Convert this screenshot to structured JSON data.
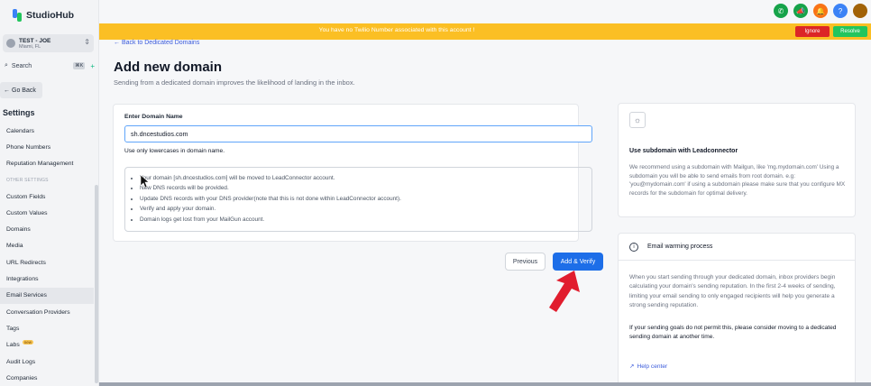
{
  "brand": {
    "name": "StudioHub"
  },
  "account": {
    "name": "TEST - JOE",
    "location": "Miami, FL"
  },
  "search": {
    "label": "Search",
    "shortcut": "⌘K",
    "plus": "+"
  },
  "sidebar": {
    "back_label": "Go Back",
    "settings_title": "Settings",
    "items": [
      {
        "label": "Calendars"
      },
      {
        "label": "Phone Numbers"
      },
      {
        "label": "Reputation Management"
      },
      {
        "label": "OTHER SETTINGS",
        "section": true
      },
      {
        "label": "Custom Fields"
      },
      {
        "label": "Custom Values"
      },
      {
        "label": "Domains"
      },
      {
        "label": "Media"
      },
      {
        "label": "URL Redirects"
      },
      {
        "label": "Integrations"
      },
      {
        "label": "Email Services",
        "active": true
      },
      {
        "label": "Conversation Providers"
      },
      {
        "label": "Tags"
      },
      {
        "label": "Labs",
        "badge": "new"
      },
      {
        "label": "Audit Logs"
      },
      {
        "label": "Companies"
      }
    ]
  },
  "top_icons": [
    {
      "name": "phone-icon",
      "glyph": "✆",
      "color": "#16a34a"
    },
    {
      "name": "megaphone-icon",
      "glyph": "📣",
      "color": "#16a34a"
    },
    {
      "name": "bell-icon",
      "glyph": "🔔",
      "color": "#f97316"
    },
    {
      "name": "help-icon",
      "glyph": "?",
      "color": "#3b82f6"
    }
  ],
  "banner": {
    "text": "You have no Twilio Number associated with this account !",
    "ignore_label": "Ignore",
    "resolve_label": "Resolve",
    "color": "#fbbf24"
  },
  "main": {
    "back_link": "Back to Dedicated Domains",
    "title": "Add new domain",
    "subtitle": "Sending from a dedicated domain improves the likelihood of landing in the inbox.",
    "field_label": "Enter Domain Name",
    "domain_value": "sh.dncestudios.com",
    "helper": "Use only lowercases in domain name.",
    "steps": [
      "Your domain [sh.dncestudios.com] will be moved to LeadConnector account.",
      "New DNS records will be provided.",
      "Update DNS records with your DNS provider(note that this is not done within LeadConnector account).",
      "Verify and apply your domain.",
      "Domain logs get lost from your MailGun account."
    ],
    "previous_label": "Previous",
    "verify_label": "Add & Verify"
  },
  "tip": {
    "title": "Use subdomain with Leadconnector",
    "body": "We recommend using a subdomain with Mailgun, like 'mg.mydomain.com' Using a subdomain you will be able to send emails from root domain. e.g: 'you@mydomain.com' if using a subdomain please make sure that you configure MX records for the subdomain for optimal delivery."
  },
  "warming": {
    "title": "Email warming process",
    "body": "When you start sending through your dedicated domain, inbox providers begin calculating your domain's sending reputation. In the first 2-4 weeks of sending, limiting your email sending to only engaged recipients will help you generate a strong sending reputation.",
    "note": "If your sending goals do not permit this, please consider moving to a dedicated sending domain at another time.",
    "help_label": "Help center"
  },
  "colors": {
    "primary": "#1d6ee8",
    "danger": "#dc2626",
    "success": "#22c55e",
    "arrow": "#e11d2e"
  }
}
